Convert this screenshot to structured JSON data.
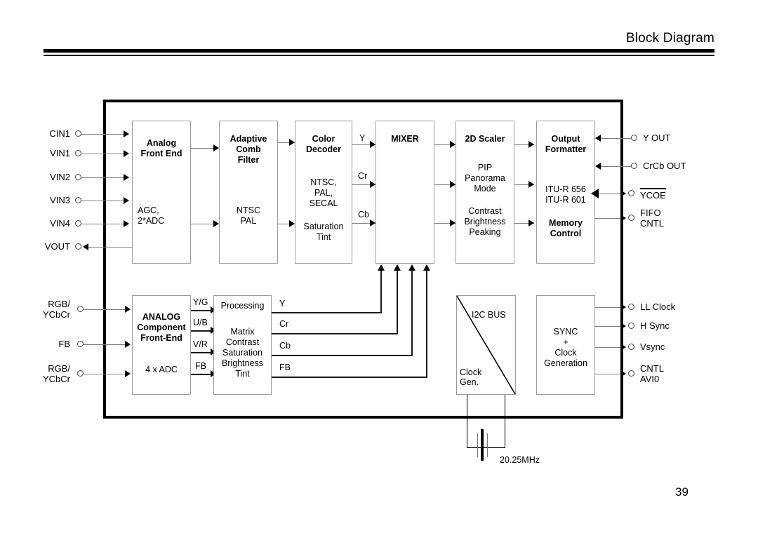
{
  "header": {
    "title": "Block Diagram"
  },
  "page": {
    "number": "39"
  },
  "inputs_top": [
    {
      "name": "CIN1"
    },
    {
      "name": "VIN1"
    },
    {
      "name": "VIN2"
    },
    {
      "name": "VIN3"
    },
    {
      "name": "VIN4"
    },
    {
      "name": "VOUT"
    }
  ],
  "inputs_bottom": [
    {
      "line1": "RGB/",
      "line2": "YCbCr"
    },
    {
      "line1": "FB",
      "line2": ""
    },
    {
      "line1": "RGB/",
      "line2": "YCbCr"
    }
  ],
  "outputs_top": [
    {
      "line1": "Y OUT",
      "line2": "",
      "overline": false
    },
    {
      "line1": "CrCb OUT",
      "line2": "",
      "overline": false
    },
    {
      "line1": "YCOE",
      "line2": "",
      "overline": true
    },
    {
      "line1": "FIFO",
      "line2": "CNTL",
      "overline": false
    }
  ],
  "outputs_bottom": [
    {
      "line1": "LL Clock",
      "line2": ""
    },
    {
      "line1": "H Sync",
      "line2": ""
    },
    {
      "line1": "Vsync",
      "line2": ""
    },
    {
      "line1": "CNTL",
      "line2": "AVI0"
    }
  ],
  "blocks": {
    "analog_front_end": {
      "title1": "Analog",
      "title2": "Front End",
      "body1": "AGC,",
      "body2": "2*ADC"
    },
    "adaptive_comb_filter": {
      "title1": "Adaptive",
      "title2": "Comb",
      "title3": "Filter",
      "body1": "NTSC",
      "body2": "PAL"
    },
    "color_decoder": {
      "title1": "Color",
      "title2": "Decoder",
      "body1": "NTSC,",
      "body2": "PAL,",
      "body3": "SECAL",
      "body4": "Saturation",
      "body5": "Tint"
    },
    "mixer": {
      "title": "MIXER"
    },
    "scaler_2d": {
      "title": "2D Scaler",
      "body1": "PIP",
      "body2": "Panorama",
      "body3": "Mode",
      "body4": "Contrast",
      "body5": "Brightness",
      "body6": "Peaking"
    },
    "output_formatter": {
      "title1": "Output",
      "title2": "Formatter",
      "body1": "ITU-R 656",
      "body2": "ITU-R 601",
      "title3": "Memory",
      "title4": "Control"
    },
    "analog_component_front_end": {
      "title1": "ANALOG",
      "title2": "Component",
      "title3": "Front-End",
      "body1": "4 x ADC"
    },
    "processing": {
      "title": "Processing",
      "body1": "Matrix",
      "body2": "Contrast",
      "body3": "Saturation",
      "body4": "Brightness",
      "body5": "Tint"
    },
    "i2c_clock": {
      "label_top": "I2C BUS",
      "label_bottom1": "Clock",
      "label_bottom2": "Gen."
    },
    "sync_clock": {
      "body1": "SYNC",
      "body2": "+",
      "body3": "Clock",
      "body4": "Generation"
    }
  },
  "signals": {
    "decoder_out": [
      "Y",
      "Cr",
      "Cb"
    ],
    "component_in": [
      "Y/G",
      "U/B",
      "V/R",
      "FB"
    ],
    "processing_out": [
      "Y",
      "Cr",
      "Cb",
      "FB"
    ]
  },
  "crystal": {
    "frequency": "20.25MHz"
  }
}
